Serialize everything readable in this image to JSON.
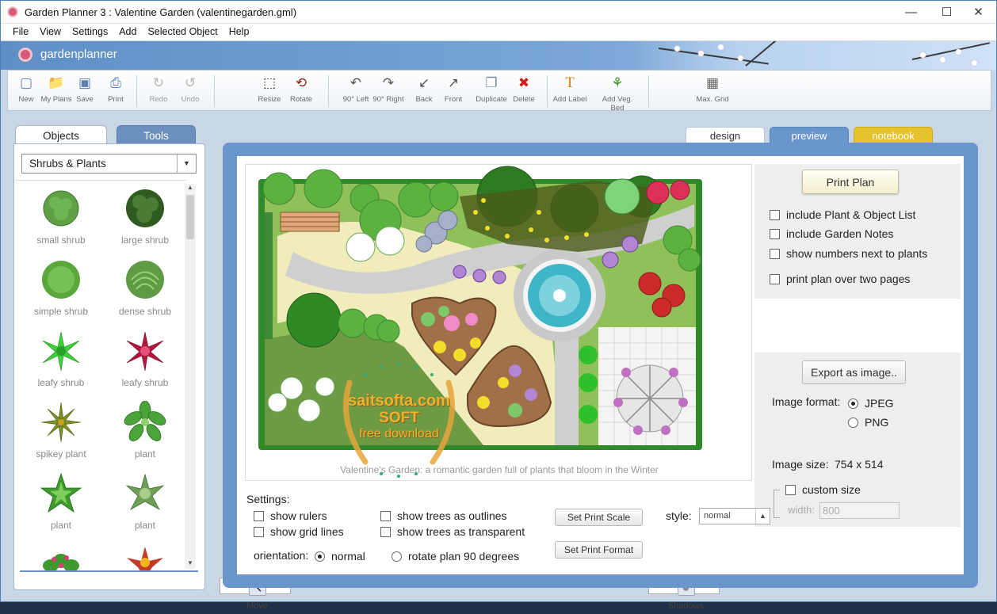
{
  "window": {
    "title": "Garden Planner 3 : Valentine Garden (valentinegarden.gml)",
    "controls": [
      "—",
      "☐",
      "✕"
    ]
  },
  "menu": [
    "File",
    "View",
    "Settings",
    "Add",
    "Selected Object",
    "Help"
  ],
  "brand": {
    "name": "gardenplanner"
  },
  "toolbar": [
    {
      "label": "New",
      "icon": "new-file-icon",
      "glyph": "🗋"
    },
    {
      "label": "My Plans",
      "icon": "folder-icon",
      "glyph": "🗁"
    },
    {
      "label": "Save",
      "icon": "save-icon",
      "glyph": "💾"
    },
    {
      "label": "Print",
      "icon": "print-icon",
      "glyph": "⎙"
    },
    {
      "label": "Redo",
      "icon": "redo-icon",
      "glyph": "↻"
    },
    {
      "label": "Undo",
      "icon": "undo-icon",
      "glyph": "↺"
    },
    {
      "label": "Move",
      "icon": "move-cursor-icon",
      "glyph": "↖"
    },
    {
      "label": "Resize",
      "icon": "resize-icon",
      "glyph": "⬚"
    },
    {
      "label": "Rotate",
      "icon": "rotate-icon",
      "glyph": "⟲"
    },
    {
      "label": "90° Left",
      "icon": "rotate-left-icon",
      "glyph": "↶"
    },
    {
      "label": "90° Right",
      "icon": "rotate-right-icon",
      "glyph": "↷"
    },
    {
      "label": "Back",
      "icon": "send-back-icon",
      "glyph": "↙"
    },
    {
      "label": "Front",
      "icon": "bring-front-icon",
      "glyph": "↗"
    },
    {
      "label": "Duplicate",
      "icon": "duplicate-icon",
      "glyph": "❐"
    },
    {
      "label": "Delete",
      "icon": "delete-icon",
      "glyph": "✖"
    },
    {
      "label": "Add Label",
      "icon": "label-icon",
      "glyph": "T"
    },
    {
      "label": "Add Veg. Bed",
      "icon": "veg-bed-icon",
      "glyph": "⚘"
    },
    {
      "label": "Shadows",
      "icon": "shadows-icon",
      "glyph": "●"
    },
    {
      "label": "Max. Grid",
      "icon": "grid-icon",
      "glyph": "▦"
    }
  ],
  "left_tabs": {
    "objects": "Objects",
    "tools": "Tools"
  },
  "category": "Shrubs & Plants",
  "plants": [
    {
      "label": "small shrub",
      "color": "#5fa046"
    },
    {
      "label": "large shrub",
      "color": "#3e6b2c"
    },
    {
      "label": "simple shrub",
      "color": "#67b84a"
    },
    {
      "label": "dense shrub",
      "color": "#73ad52"
    },
    {
      "label": "leafy shrub",
      "color": "#3fcf3a"
    },
    {
      "label": "leafy shrub",
      "color": "#b3163c"
    },
    {
      "label": "spikey plant",
      "color": "#7a8f24"
    },
    {
      "label": "plant",
      "color": "#4aa43a"
    },
    {
      "label": "plant",
      "color": "#4fa83b"
    },
    {
      "label": "plant",
      "color": "#6f9e56"
    }
  ],
  "right_tabs": {
    "design": "design",
    "preview": "preview",
    "notebook": "notebook"
  },
  "preview": {
    "caption": "Valentine's Garden: a romantic garden full of plants that bloom in the Winter",
    "watermark": {
      "line1": "saitsofta.com",
      "line2": "SOFT",
      "line3": "free download"
    }
  },
  "print_panel": {
    "print_button": "Print Plan",
    "options": [
      {
        "label": "include Plant & Object List",
        "checked": false
      },
      {
        "label": "include Garden Notes",
        "checked": false
      },
      {
        "label": "show numbers next to plants",
        "checked": false
      },
      {
        "label": "print plan over two pages",
        "checked": false
      }
    ]
  },
  "export_panel": {
    "export_button": "Export as image..",
    "format_label": "Image format:",
    "formats": [
      {
        "label": "JPEG",
        "selected": true
      },
      {
        "label": "PNG",
        "selected": false
      }
    ],
    "size_label": "Image size:",
    "size_value": "754 x 514",
    "custom_size": "custom size",
    "width_label": "width:",
    "width_value": "800"
  },
  "settings": {
    "title": "Settings:",
    "show_rulers": "show rulers",
    "show_grid_lines": "show grid lines",
    "show_trees_outlines": "show trees as outlines",
    "show_trees_transparent": "show trees as transparent",
    "set_print_scale": "Set Print Scale",
    "set_print_format": "Set Print Format",
    "style_label": "style:",
    "style_value": "normal",
    "orientation_label": "orientation:",
    "orientation_normal": "normal",
    "orientation_rotate": "rotate plan 90 degrees"
  }
}
